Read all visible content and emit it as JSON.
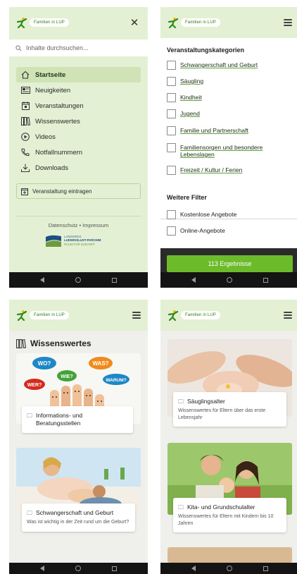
{
  "brand": {
    "logo_text": "Familien in LUP",
    "accent": "#6bbb2a",
    "header_bg": "#e3f0d3"
  },
  "menu_screen": {
    "close_icon": "close-icon",
    "search_placeholder": "Inhalte durchsuchen...",
    "items": [
      {
        "label": "Startseite",
        "icon": "home-icon",
        "active": true
      },
      {
        "label": "Neuigkeiten",
        "icon": "newspaper-icon",
        "active": false
      },
      {
        "label": "Veranstaltungen",
        "icon": "calendar-icon",
        "active": false
      },
      {
        "label": "Wissenswertes",
        "icon": "books-icon",
        "active": false
      },
      {
        "label": "Videos",
        "icon": "play-icon",
        "active": false
      },
      {
        "label": "Notfallnummern",
        "icon": "phone-icon",
        "active": false
      },
      {
        "label": "Downloads",
        "icon": "download-icon",
        "active": false
      }
    ],
    "event_button": "Veranstaltung eintragen",
    "legal": "Datenschutz • Impressum",
    "district_logo": {
      "line1": "LANDKREIS",
      "line2": "LUDWIGSLUST-PARCHIM",
      "line3": "RAUM FÜR ZUKUNFT"
    }
  },
  "filter_screen": {
    "categories_title": "Veranstaltungskategorien",
    "categories": [
      "Schwangerschaft und Geburt",
      "Säugling",
      "Kindheit",
      "Jugend",
      "Familie und Partnerschaft",
      "Familiensorgen und besondere Lebenslagen",
      "Freizeit / Kultur / Ferien"
    ],
    "more_title": "Weitere Filter",
    "more": [
      "Kostenlose Angebote",
      "Online-Angebote"
    ],
    "results_button": "113 Ergebnisse"
  },
  "wissen_screen": {
    "heading": "Wissenswertes",
    "bubbles": [
      "WO?",
      "WAS?",
      "WIE?",
      "WER?",
      "WARUM?"
    ],
    "cards": [
      {
        "title": "Informations- und Beratungsstellen",
        "desc": ""
      },
      {
        "title": "Schwangerschaft und Geburt",
        "desc": "Was ist wichtig in der Zeit rund um die Geburt?"
      }
    ]
  },
  "detail_screen": {
    "cards": [
      {
        "title": "Säuglingsalter",
        "desc": "Wissenswertes für Eltern über das erste Lebensjahr"
      },
      {
        "title": "Kita- und Grundschulalter",
        "desc": "Wissenswertes für Eltern mit Kindern bis 10 Jahren"
      }
    ]
  }
}
